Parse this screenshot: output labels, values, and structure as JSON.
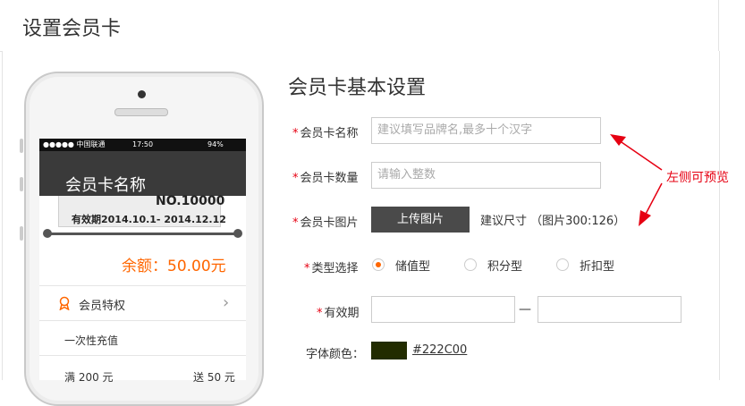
{
  "page": {
    "title": "设置会员卡"
  },
  "preview": {
    "status": {
      "carrier": "●●●●● 中国联通",
      "time": "17:50",
      "battery": "94%"
    },
    "card_name": "会员卡名称",
    "card_no": "NO.10000",
    "validity": "有效期2014.10.1- 2014.12.12",
    "balance": "余额：50.00元",
    "privilege_label": "会员特权",
    "benefits": [
      {
        "label": "一次性充值"
      },
      {
        "label": "满 200 元",
        "reward": "送 50 元"
      }
    ]
  },
  "form": {
    "title": "会员卡基本设置",
    "required_mark": "*",
    "name_label": "会员卡名称",
    "name_placeholder": "建议填写品牌名,最多十个汉字",
    "qty_label": "会员卡数量",
    "qty_placeholder": "请输入整数",
    "image_label": "会员卡图片",
    "upload_label": "上传图片",
    "size_hint": "建议尺寸  （图片300:126）",
    "type_label": "类型选择",
    "types": [
      {
        "label": "储值型",
        "selected": true
      },
      {
        "label": "积分型",
        "selected": false
      },
      {
        "label": "折扣型",
        "selected": false
      }
    ],
    "validity_label": "有效期",
    "validity_sep": "—",
    "font_color_label": "字体颜色：",
    "font_color": "#222C00",
    "font_color_text": "#222C00"
  },
  "annotation": {
    "text": "左侧可预览",
    "color": "#e60012"
  }
}
